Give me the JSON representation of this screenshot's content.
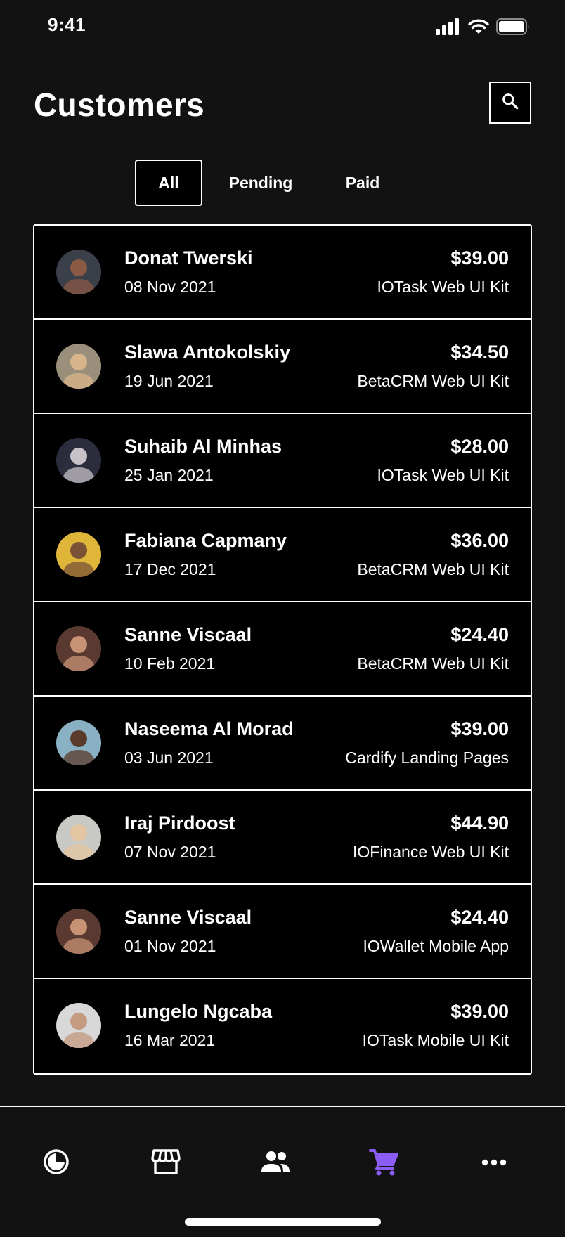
{
  "status_bar": {
    "time": "9:41",
    "icons": [
      "signal-icon",
      "wifi-icon",
      "battery-icon"
    ]
  },
  "header": {
    "title": "Customers",
    "search_icon": "search-icon"
  },
  "tabs": [
    {
      "label": "All",
      "active": true
    },
    {
      "label": "Pending",
      "active": false
    },
    {
      "label": "Paid",
      "active": false
    }
  ],
  "customers": [
    {
      "name": "Donat Twerski",
      "date": "08 Nov 2021",
      "amount": "$39.00",
      "product": "IOTask Web UI Kit",
      "avatar_colors": [
        "#3a3f4a",
        "#8a5a44"
      ]
    },
    {
      "name": "Slawa Antokolskiy",
      "date": "19 Jun 2021",
      "amount": "$34.50",
      "product": "BetaCRM Web UI Kit",
      "avatar_colors": [
        "#9a8f7a",
        "#d8b48a"
      ]
    },
    {
      "name": "Suhaib Al Minhas",
      "date": "25 Jan 2021",
      "amount": "$28.00",
      "product": "IOTask Web UI Kit",
      "avatar_colors": [
        "#2b2d3c",
        "#c8c2c8"
      ]
    },
    {
      "name": "Fabiana Capmany",
      "date": "17 Dec 2021",
      "amount": "$36.00",
      "product": "BetaCRM Web UI Kit",
      "avatar_colors": [
        "#e0b63a",
        "#7a5236"
      ]
    },
    {
      "name": "Sanne Viscaal",
      "date": "10 Feb 2021",
      "amount": "$24.40",
      "product": "BetaCRM Web UI Kit",
      "avatar_colors": [
        "#5a3a30",
        "#c89274"
      ]
    },
    {
      "name": "Naseema Al Morad",
      "date": "03 Jun 2021",
      "amount": "$39.00",
      "product": "Cardify Landing Pages",
      "avatar_colors": [
        "#8ab0c4",
        "#5a3a2a"
      ]
    },
    {
      "name": "Iraj Pirdoost",
      "date": "07 Nov 2021",
      "amount": "$44.90",
      "product": "IOFinance Web UI Kit",
      "avatar_colors": [
        "#c8c8c4",
        "#e4c6a2"
      ]
    },
    {
      "name": "Sanne Viscaal",
      "date": "01 Nov 2021",
      "amount": "$24.40",
      "product": "IOWallet Mobile App",
      "avatar_colors": [
        "#5a3a30",
        "#c89274"
      ]
    },
    {
      "name": "Lungelo Ngcaba",
      "date": "16 Mar 2021",
      "amount": "$39.00",
      "product": "IOTask Mobile UI Kit",
      "avatar_colors": [
        "#d8d8d8",
        "#c49a80"
      ]
    }
  ],
  "bottom_nav": {
    "items": [
      {
        "icon": "dashboard-icon",
        "active": false
      },
      {
        "icon": "store-icon",
        "active": false
      },
      {
        "icon": "people-icon",
        "active": false
      },
      {
        "icon": "cart-icon",
        "active": true
      },
      {
        "icon": "more-icon",
        "active": false
      }
    ],
    "active_color": "#8b5cf6",
    "inactive_color": "#ffffff"
  },
  "colors": {
    "background": "#121212",
    "surface": "#000000",
    "border": "#ffffff",
    "accent": "#8b5cf6"
  }
}
